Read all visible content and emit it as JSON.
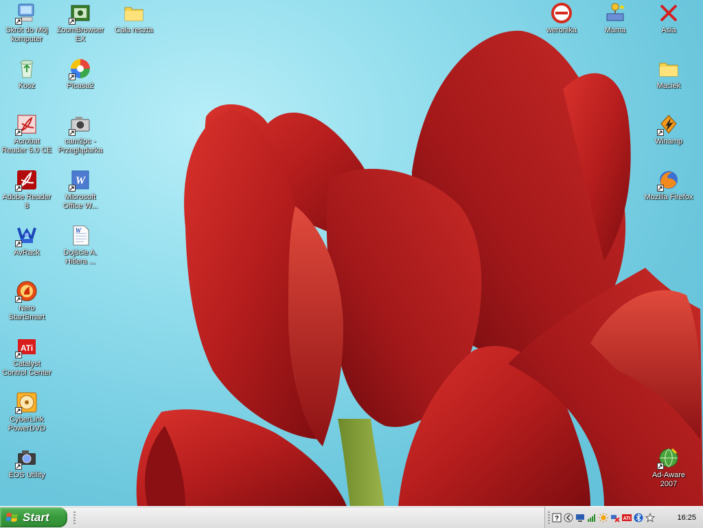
{
  "desktop": {
    "left_icons": [
      {
        "label": "Skrót do Mój komputer",
        "icon": "my-computer-icon"
      },
      {
        "label": "Kosz",
        "icon": "recycle-bin-icon"
      },
      {
        "label": "Acrobat Reader 5.0 CE",
        "icon": "acrobat-icon"
      },
      {
        "label": "Adobe Reader 8",
        "icon": "adobe-reader-icon"
      },
      {
        "label": "AvRack",
        "icon": "avrack-icon"
      },
      {
        "label": "Nero StartSmart",
        "icon": "nero-icon"
      },
      {
        "label": "Catalyst Control Center",
        "icon": "ati-icon"
      },
      {
        "label": "CyberLink PowerDVD",
        "icon": "powerdvd-icon"
      },
      {
        "label": "EOS Utility",
        "icon": "camera-icon"
      }
    ],
    "second_column_icons": [
      {
        "label": "ZoomBrowser EX",
        "icon": "zoombrowser-icon"
      },
      {
        "label": "Picasa2",
        "icon": "picasa-icon"
      },
      {
        "label": "cam2pc - Przeglądarka",
        "icon": "camera-icon"
      },
      {
        "label": "Microsoft Office W...",
        "icon": "word-icon"
      },
      {
        "label": "Dojście A. Hitlera ...",
        "icon": "word-document-icon"
      }
    ],
    "third_column_icons": [
      {
        "label": "Cała reszta",
        "icon": "folder-icon"
      }
    ],
    "right_icons": [
      {
        "label": "weronika",
        "icon": "user-blocked-icon"
      },
      {
        "label": "Mama",
        "icon": "network-user-icon"
      },
      {
        "label": "Asia",
        "icon": "red-x-icon"
      },
      {
        "label": "Maciek",
        "icon": "folder-icon"
      },
      {
        "label": "Winamp",
        "icon": "winamp-icon"
      },
      {
        "label": "Mozilla Firefox",
        "icon": "firefox-icon"
      },
      {
        "label": "Ad-Aware 2007",
        "icon": "adaware-icon"
      }
    ]
  },
  "taskbar": {
    "start_label": "Start",
    "clock": "16:25",
    "tray_icons": [
      "help-icon",
      "back-arrow-icon",
      "monitor-icon",
      "signal-bars-icon",
      "sun-icon",
      "network-x-icon",
      "ati-tray-icon",
      "bluetooth-icon",
      "star-icon"
    ]
  },
  "colors": {
    "sky": "#7fd2e6",
    "tulip": "#b81e1e",
    "start_green": "#3a9c3e"
  }
}
